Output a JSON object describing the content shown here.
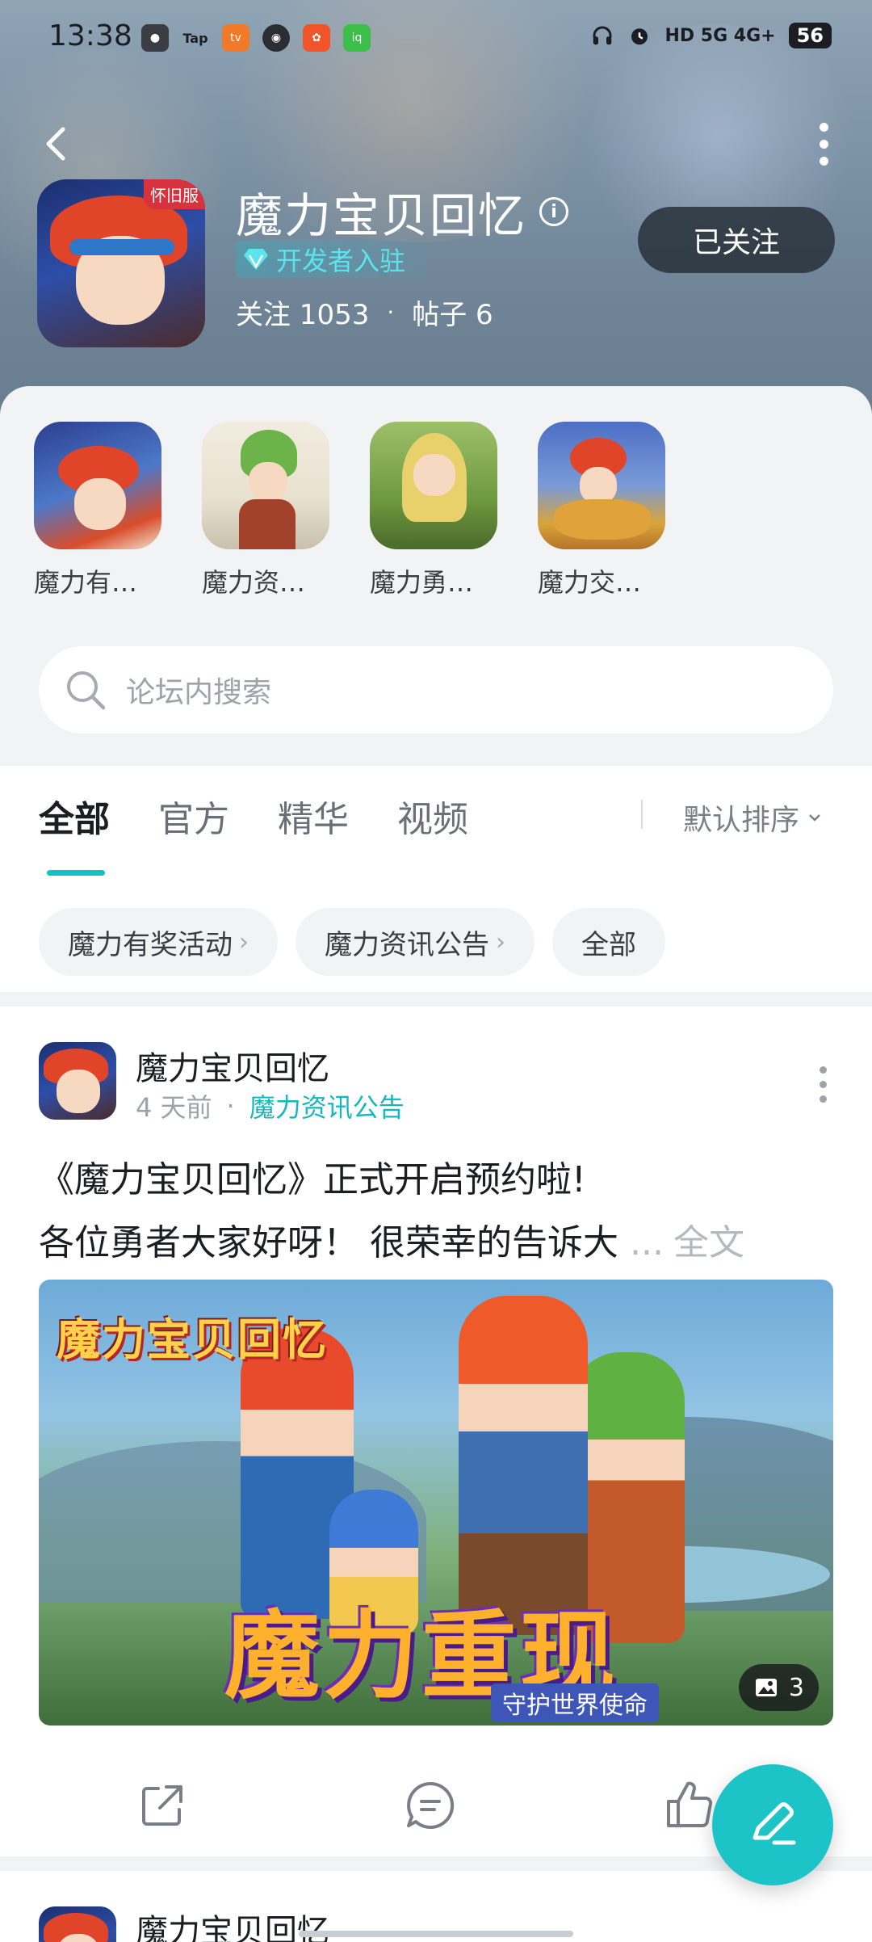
{
  "status_bar": {
    "time": "13:38",
    "app_icons": [
      "wechat-icon",
      "tap-icon",
      "bilibili-icon",
      "compass-icon",
      "red-app-icon",
      "iqiyi-icon"
    ],
    "indicators": "HD 5G 4G+",
    "battery": "56"
  },
  "header": {
    "title": "魔力宝贝回忆",
    "dev_badge": "开发者入驻",
    "follow_label": "关注 1053",
    "separator": "·",
    "posts_label": "帖子 6",
    "follow_button": "已关注",
    "icon_badge": "怀旧服"
  },
  "related_forums": [
    {
      "label": "魔力有…"
    },
    {
      "label": "魔力资…"
    },
    {
      "label": "魔力勇…"
    },
    {
      "label": "魔力交…"
    }
  ],
  "search": {
    "placeholder": "论坛内搜索"
  },
  "tabs": [
    {
      "label": "全部",
      "active": true
    },
    {
      "label": "官方",
      "active": false
    },
    {
      "label": "精华",
      "active": false
    },
    {
      "label": "视频",
      "active": false
    }
  ],
  "sort_label": "默认排序",
  "chips": [
    {
      "label": "魔力有奖活动",
      "arrow": "›"
    },
    {
      "label": "魔力资讯公告",
      "arrow": "›"
    },
    {
      "label": "全部"
    }
  ],
  "post": {
    "author": "魔力宝贝回忆",
    "time": "4 天前",
    "separator": "·",
    "category": "魔力资讯公告",
    "title": "《魔力宝贝回忆》正式开启预约啦!",
    "excerpt": "各位勇者大家好呀！ 很荣幸的告诉大",
    "ellipsis": "...",
    "full_text": "全文",
    "banner_logo": "魔力宝贝回忆",
    "banner_title": "魔力重现",
    "banner_subtitle": "守护世界使命",
    "image_count": "3"
  },
  "post2": {
    "author": "魔力宝贝回忆"
  },
  "colors": {
    "accent": "#1cc4c8",
    "category": "#14b8bf",
    "dev_badge": "#5ae5ec"
  }
}
